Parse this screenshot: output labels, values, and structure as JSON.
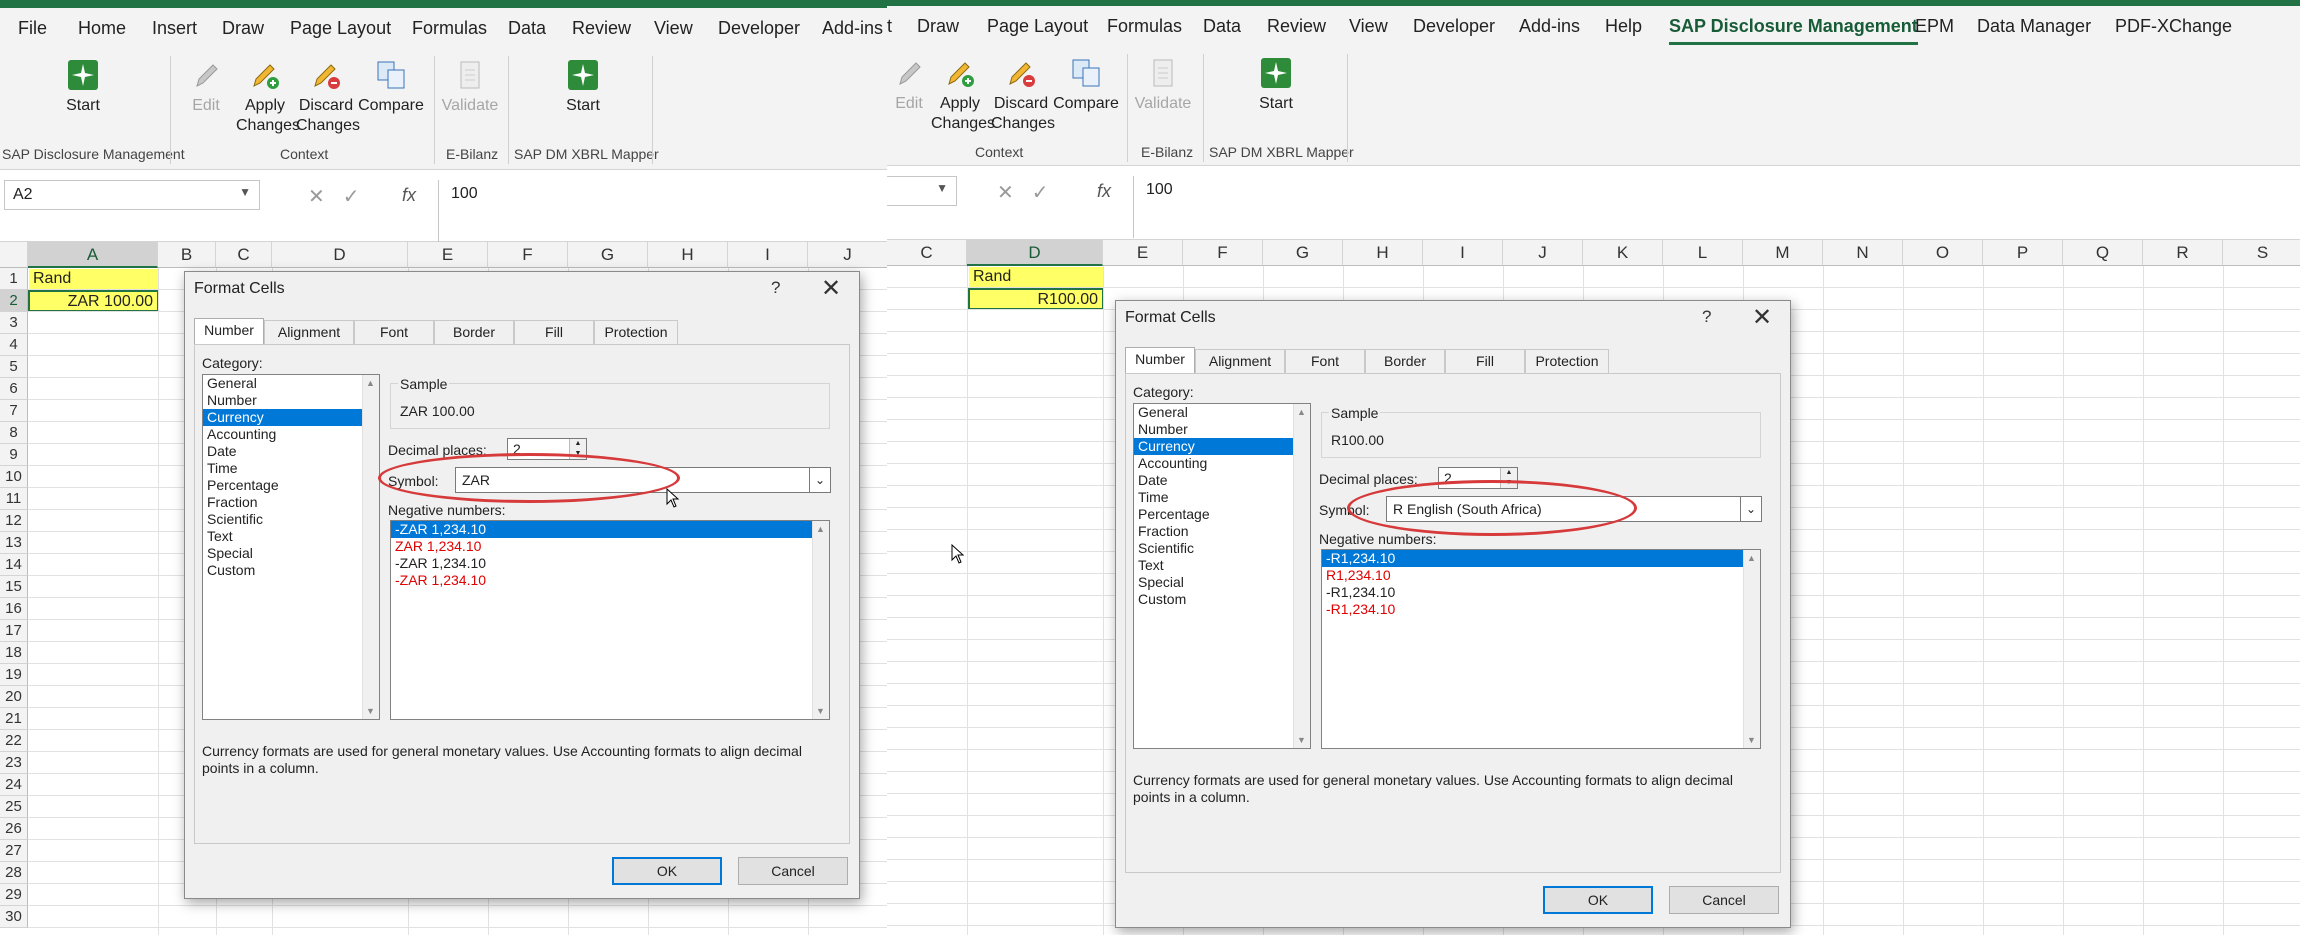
{
  "left": {
    "tabs": [
      "File",
      "Home",
      "Insert",
      "Draw",
      "Page Layout",
      "Formulas",
      "Data",
      "Review",
      "View",
      "Developer",
      "Add-ins"
    ],
    "ribbon": {
      "start_label": "Start",
      "group_sap": "SAP Disclosure Management",
      "edit_label": "Edit",
      "apply_label_1": "Apply",
      "apply_label_2": "Changes",
      "discard_label_1": "Discard",
      "discard_label_2": "Changes",
      "compare_label": "Compare",
      "group_context": "Context",
      "validate_label": "Validate",
      "group_ebilanz": "E-Bilanz",
      "start2_label": "Start",
      "group_xbrl": "SAP DM XBRL Mapper"
    },
    "namebox": "A2",
    "formula_value": "100",
    "columns": [
      "A",
      "B",
      "C",
      "D",
      "E",
      "F",
      "G",
      "H",
      "I",
      "J"
    ],
    "cells": {
      "a1": "Rand",
      "a2": "ZAR 100.00"
    },
    "dialog": {
      "title": "Format Cells",
      "help": "?",
      "close": "✕",
      "tabs": [
        "Number",
        "Alignment",
        "Font",
        "Border",
        "Fill",
        "Protection"
      ],
      "category_label": "Category:",
      "categories": [
        "General",
        "Number",
        "Currency",
        "Accounting",
        "Date",
        "Time",
        "Percentage",
        "Fraction",
        "Scientific",
        "Text",
        "Special",
        "Custom"
      ],
      "sample_label": "Sample",
      "sample_value": "ZAR 100.00",
      "decimal_label": "Decimal places:",
      "decimal_value": "2",
      "symbol_label": "Symbol:",
      "symbol_value": "ZAR",
      "negative_label": "Negative numbers:",
      "negatives": [
        "-ZAR 1,234.10",
        "ZAR 1,234.10",
        "-ZAR 1,234.10",
        "-ZAR 1,234.10"
      ],
      "description": "Currency formats are used for general monetary values.  Use Accounting formats to align decimal points in a column.",
      "ok_label": "OK",
      "cancel_label": "Cancel"
    }
  },
  "right": {
    "tabs": [
      "t",
      "Draw",
      "Page Layout",
      "Formulas",
      "Data",
      "Review",
      "View",
      "Developer",
      "Add-ins",
      "Help",
      "SAP Disclosure Management",
      "EPM",
      "Data Manager",
      "PDF-XChange"
    ],
    "ribbon": {
      "edit_label": "Edit",
      "apply_label_1": "Apply",
      "apply_label_2": "Changes",
      "discard_label_1": "Discard",
      "discard_label_2": "Changes",
      "compare_label": "Compare",
      "group_context": "Context",
      "validate_label": "Validate",
      "group_ebilanz": "E-Bilanz",
      "start_label": "Start",
      "group_xbrl": "SAP DM XBRL Mapper"
    },
    "formula_value": "100",
    "columns": [
      "C",
      "D",
      "E",
      "F",
      "G",
      "H",
      "I",
      "J",
      "K",
      "L",
      "M",
      "N",
      "O",
      "P",
      "Q",
      "R",
      "S"
    ],
    "cells": {
      "d1": "Rand",
      "d2": "R100.00"
    },
    "dialog": {
      "title": "Format Cells",
      "help": "?",
      "close": "✕",
      "tabs": [
        "Number",
        "Alignment",
        "Font",
        "Border",
        "Fill",
        "Protection"
      ],
      "category_label": "Category:",
      "categories": [
        "General",
        "Number",
        "Currency",
        "Accounting",
        "Date",
        "Time",
        "Percentage",
        "Fraction",
        "Scientific",
        "Text",
        "Special",
        "Custom"
      ],
      "sample_label": "Sample",
      "sample_value": "R100.00",
      "decimal_label": "Decimal places:",
      "decimal_value": "2",
      "symbol_label": "Symbol:",
      "symbol_value": "R English (South Africa)",
      "negative_label": "Negative numbers:",
      "negatives": [
        "-R1,234.10",
        "R1,234.10",
        "-R1,234.10",
        "-R1,234.10"
      ],
      "description": "Currency formats are used for general monetary values.  Use Accounting formats to align decimal points in a column.",
      "ok_label": "OK",
      "cancel_label": "Cancel"
    }
  },
  "row_numbers": [
    "1",
    "2",
    "3",
    "4",
    "5",
    "6",
    "7",
    "8",
    "9",
    "10",
    "11",
    "12",
    "13",
    "14",
    "15",
    "16",
    "17",
    "18",
    "19",
    "20",
    "21",
    "22",
    "23",
    "24",
    "25",
    "26",
    "27",
    "28",
    "29",
    "30"
  ],
  "colors": {
    "excel_green": "#217346",
    "highlight_yellow": "#ffff66",
    "select_blue": "#0078d7",
    "annotation_red": "#d63a3a",
    "negative_red": "#e00000"
  }
}
